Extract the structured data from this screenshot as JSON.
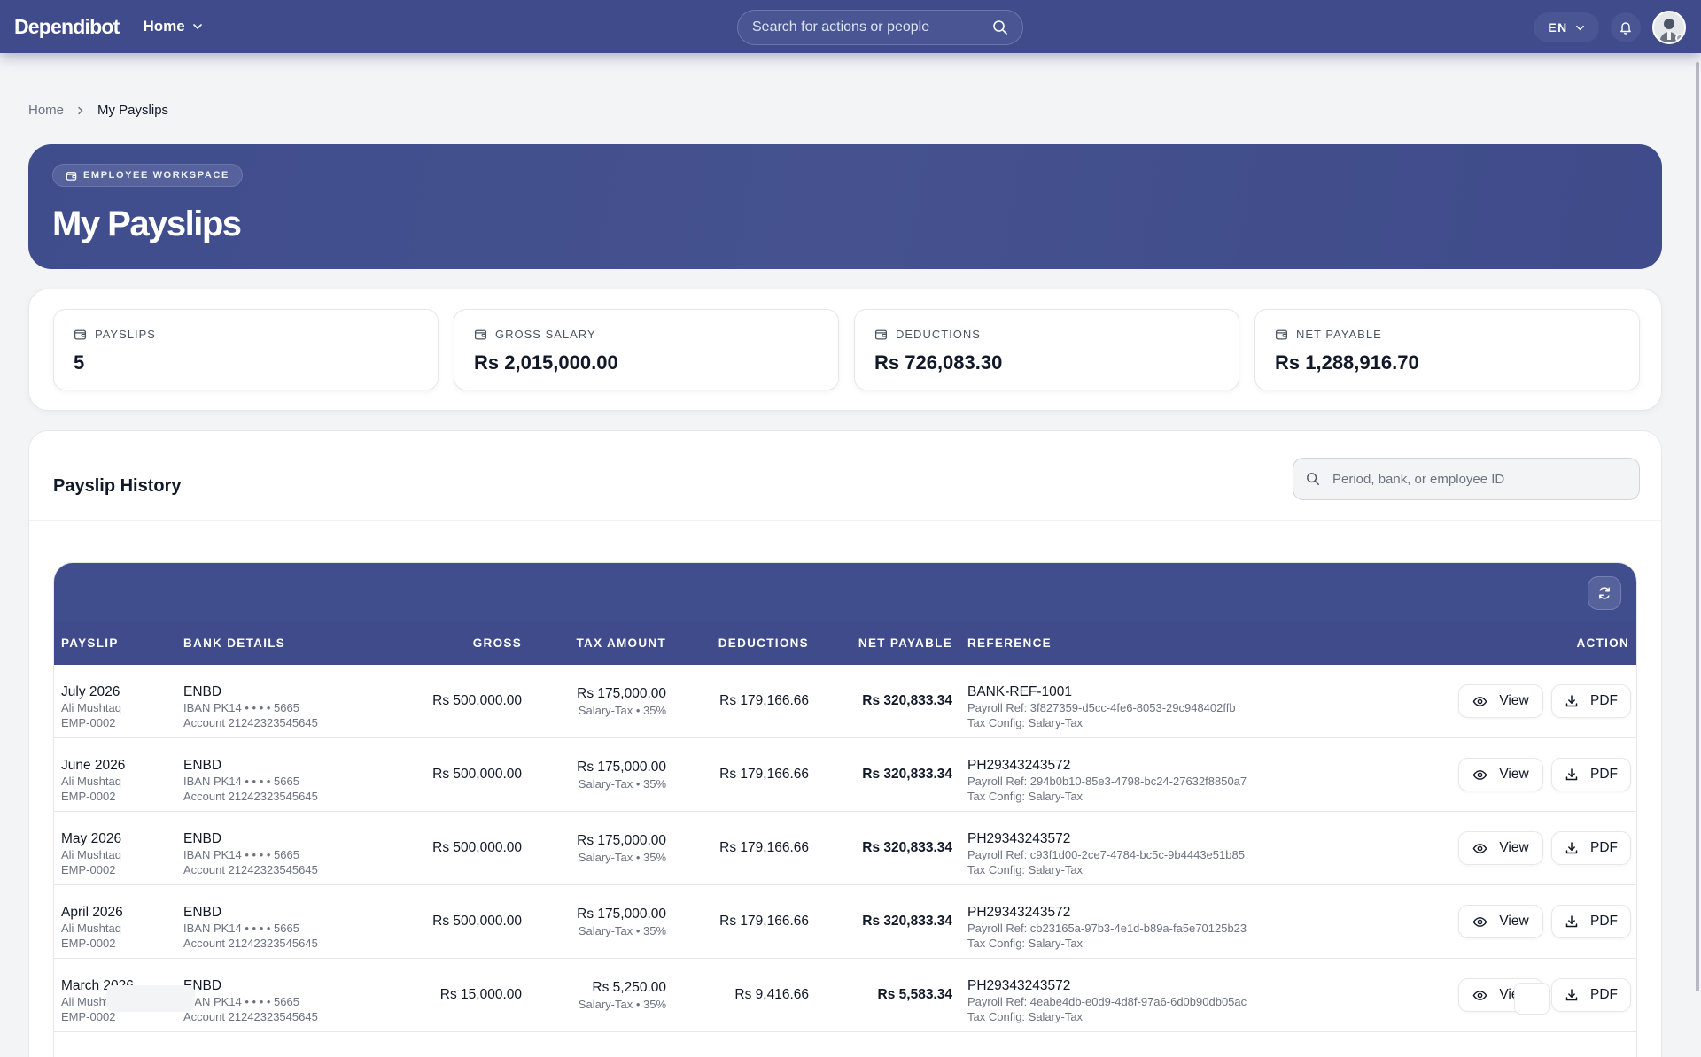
{
  "app": {
    "brand": "Dependibot",
    "nav_label": "Home"
  },
  "topbar": {
    "search_placeholder": "Search for actions or people",
    "language": "EN"
  },
  "breadcrumb": {
    "home": "Home",
    "current": "My Payslips"
  },
  "hero": {
    "badge": "EMPLOYEE WORKSPACE",
    "title": "My Payslips"
  },
  "stats": [
    {
      "label": "PAYSLIPS",
      "value": "5"
    },
    {
      "label": "GROSS SALARY",
      "value": "Rs 2,015,000.00"
    },
    {
      "label": "DEDUCTIONS",
      "value": "Rs 726,083.30"
    },
    {
      "label": "NET PAYABLE",
      "value": "Rs 1,288,916.70"
    }
  ],
  "history": {
    "title": "Payslip History",
    "search_placeholder": "Period, bank, or employee ID",
    "columns": {
      "payslip": "PAYSLIP",
      "bank": "BANK DETAILS",
      "gross": "GROSS",
      "tax": "TAX AMOUNT",
      "deductions": "DEDUCTIONS",
      "net": "NET PAYABLE",
      "reference": "REFERENCE",
      "action": "ACTION"
    },
    "view_label": "View",
    "pdf_label": "PDF",
    "rows": [
      {
        "period": "July 2026",
        "name": "Ali Mushtaq",
        "emp": "EMP-0002",
        "bank": "ENBD",
        "iban": "IBAN PK14 • • • • 5665",
        "account": "Account 21242323545645",
        "gross": "Rs 500,000.00",
        "tax": "Rs 175,000.00",
        "tax_note": "Salary-Tax • 35%",
        "deductions": "Rs 179,166.66",
        "net": "Rs 320,833.34",
        "reference": "BANK-REF-1001",
        "payroll_ref": "Payroll Ref: 3f827359-d5cc-4fe6-8053-29c948402ffb",
        "tax_config": "Tax Config: Salary-Tax"
      },
      {
        "period": "June 2026",
        "name": "Ali Mushtaq",
        "emp": "EMP-0002",
        "bank": "ENBD",
        "iban": "IBAN PK14 • • • • 5665",
        "account": "Account 21242323545645",
        "gross": "Rs 500,000.00",
        "tax": "Rs 175,000.00",
        "tax_note": "Salary-Tax • 35%",
        "deductions": "Rs 179,166.66",
        "net": "Rs 320,833.34",
        "reference": "PH29343243572",
        "payroll_ref": "Payroll Ref: 294b0b10-85e3-4798-bc24-27632f8850a7",
        "tax_config": "Tax Config: Salary-Tax"
      },
      {
        "period": "May 2026",
        "name": "Ali Mushtaq",
        "emp": "EMP-0002",
        "bank": "ENBD",
        "iban": "IBAN PK14 • • • • 5665",
        "account": "Account 21242323545645",
        "gross": "Rs 500,000.00",
        "tax": "Rs 175,000.00",
        "tax_note": "Salary-Tax • 35%",
        "deductions": "Rs 179,166.66",
        "net": "Rs 320,833.34",
        "reference": "PH29343243572",
        "payroll_ref": "Payroll Ref: c93f1d00-2ce7-4784-bc5c-9b4443e51b85",
        "tax_config": "Tax Config: Salary-Tax"
      },
      {
        "period": "April 2026",
        "name": "Ali Mushtaq",
        "emp": "EMP-0002",
        "bank": "ENBD",
        "iban": "IBAN PK14 • • • • 5665",
        "account": "Account 21242323545645",
        "gross": "Rs 500,000.00",
        "tax": "Rs 175,000.00",
        "tax_note": "Salary-Tax • 35%",
        "deductions": "Rs 179,166.66",
        "net": "Rs 320,833.34",
        "reference": "PH29343243572",
        "payroll_ref": "Payroll Ref: cb23165a-97b3-4e1d-b89a-fa5e70125b23",
        "tax_config": "Tax Config: Salary-Tax"
      },
      {
        "period": "March 2026",
        "name": "Ali Mushtaq",
        "emp": "EMP-0002",
        "bank": "ENBD",
        "iban": "IBAN PK14 • • • • 5665",
        "account": "Account 21242323545645",
        "gross": "Rs 15,000.00",
        "tax": "Rs 5,250.00",
        "tax_note": "Salary-Tax • 35%",
        "deductions": "Rs 9,416.66",
        "net": "Rs 5,583.34",
        "reference": "PH29343243572",
        "payroll_ref": "Payroll Ref: 4eabe4db-e0d9-4d8f-97a6-6d0b90db05ac",
        "tax_config": "Tax Config: Salary-Tax"
      }
    ]
  },
  "colors": {
    "primary": "#3f4b8a",
    "page_bg": "#f3f4f6",
    "card_bg": "#ffffff"
  },
  "icons": {
    "search": "search-icon",
    "bell": "bell-icon",
    "wallet": "wallet-icon",
    "eye": "eye-icon",
    "download": "download-icon",
    "refresh": "refresh-icon",
    "chevron": "chevron-down-icon"
  }
}
